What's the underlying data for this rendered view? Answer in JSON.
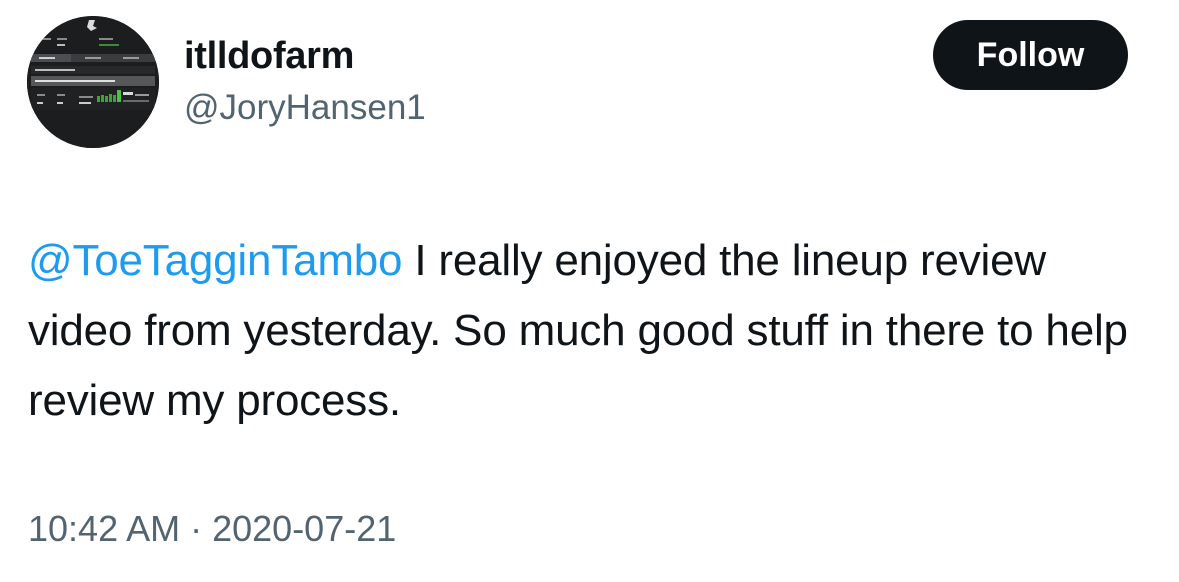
{
  "author": {
    "display_name": "itlldofarm",
    "handle": "@JoryHansen1",
    "avatar_icon": "lineup-screenshot-avatar"
  },
  "follow_button": {
    "label": "Follow"
  },
  "tweet": {
    "mention": "@ToeTagginTambo",
    "text": " I really enjoyed the lineup review video from yesterday. So much good stuff in there to help review my process."
  },
  "meta": {
    "time": "10:42 AM",
    "separator": "·",
    "date": "2020-07-21"
  },
  "colors": {
    "link": "#1d9bf0",
    "secondary_text": "#536471",
    "primary_text": "#0f1419",
    "button_bg": "#0f1419"
  }
}
